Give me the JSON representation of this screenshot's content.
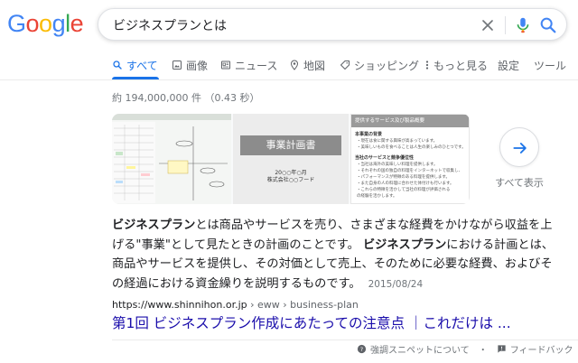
{
  "logo": {
    "text": "Google",
    "letters": [
      "G",
      "o",
      "o",
      "g",
      "l",
      "e"
    ],
    "colors": [
      "#4285f4",
      "#ea4335",
      "#fbbc05",
      "#4285f4",
      "#34a853",
      "#ea4335"
    ]
  },
  "search": {
    "query": "ビジネスプランとは"
  },
  "tabs": [
    {
      "label": "すべて",
      "icon": "search-icon",
      "active": true
    },
    {
      "label": "画像",
      "icon": "image-icon"
    },
    {
      "label": "ニュース",
      "icon": "news-icon"
    },
    {
      "label": "地図",
      "icon": "map-pin-icon"
    },
    {
      "label": "ショッピング",
      "icon": "tag-icon"
    },
    {
      "label": "もっと見る",
      "icon": "more-vert-icon"
    },
    {
      "label": "設定"
    },
    {
      "label": "ツール"
    }
  ],
  "result_stats": "約 194,000,000 件 （0.43 秒）",
  "images": {
    "plan_cover": {
      "title": "事業計画書",
      "date": "20○○年○月",
      "company": "株式会社○○フード"
    },
    "doc": {
      "title": "提供するサービス及び製品概要",
      "heading1": "本事業の背景",
      "lines1": [
        "・現在は食に関する興味が高まっています。",
        "・美味しいものを食べることは人生の楽しみのひとつです。"
      ],
      "heading2": "当社のサービスと競争優位性",
      "lines2": [
        "・当社は海外の美味しい料理を提供します。",
        "・それぞれの国の独自の料理をインターネットで収集し、",
        "・パフォーマンスが特徴のある料理を提供します。",
        "・また自身の人の料理に合わせた体付けも行います。",
        "・これらの特徴を活かして当社の料理が評価される",
        "の経験を活かします。"
      ]
    },
    "more_label": "すべて表示"
  },
  "snippet": {
    "p1_bold": "ビジネスプラン",
    "p1": "とは商品やサービスを売り、さまざまな経費をかけながら収益を上げる\"事業\"として見たときの計画のことです。",
    "p2_bold": "ビジネスプラン",
    "p2": "における計画とは、商品やサービスを提供し、その対価として売上、そのために必要な経費、およびその経過における資金繰りを説明するものです。",
    "date": "2015/08/24"
  },
  "result": {
    "url": "https://www.shinnihon.or.jp",
    "breadcrumb": " › eww › business-plan",
    "title": "第1回 ビジネスプラン作成にあたっての注意点 ｜これだけは ..."
  },
  "footer": {
    "about": "強調スニペットについて",
    "dot": "・",
    "feedback": "フィードバック"
  },
  "colors": {
    "link": "#1a0dab",
    "active_tab": "#1a73e8",
    "muted": "#70757a"
  }
}
